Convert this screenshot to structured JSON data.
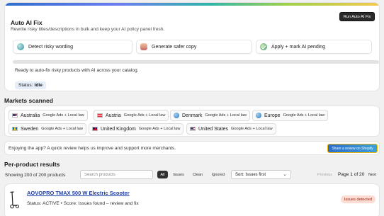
{
  "auto_fix": {
    "title": "Auto AI Fix",
    "subtitle": "Rewrite risky titles/descriptions in bulk and keep your AI policy panel fresh.",
    "run_button": "Run Auto AI Fix",
    "steps": [
      {
        "label": "Detect risky wording",
        "icon": "detect-icon"
      },
      {
        "label": "Generate safer copy",
        "icon": "generate-icon"
      },
      {
        "label": "Apply + mark AI pending",
        "icon": "check-icon"
      }
    ],
    "progress": 0,
    "message": "Ready to auto-fix risky products with AI across your catalog.",
    "status_label": "Status:",
    "status_value": "Idle"
  },
  "markets": {
    "title": "Markets scanned",
    "items": [
      {
        "name": "Australia",
        "scope": "Google Ads + Local law",
        "flag": "us"
      },
      {
        "name": "Austria",
        "scope": "Google Ads + Local law",
        "flag": "at"
      },
      {
        "name": "Denmark",
        "scope": "Google Ads + Local law",
        "flag": "globe"
      },
      {
        "name": "Europe",
        "scope": "Google Ads + Local law",
        "flag": "globe"
      },
      {
        "name": "Sweden",
        "scope": "Google Ads + Local law",
        "flag": "se"
      },
      {
        "name": "United Kingdom",
        "scope": "Google Ads + Local law",
        "flag": "uk"
      },
      {
        "name": "United States",
        "scope": "Google Ads + Local law",
        "flag": "us"
      }
    ]
  },
  "review": {
    "text": "Enjoying the app? A quick review helps us improve and support more merchants.",
    "button": "Share a review on Shopify"
  },
  "products": {
    "title": "Per-product results",
    "count": "Showing 200 of 200 products",
    "search_placeholder": "Search products",
    "filters": [
      "All",
      "Issues",
      "Clean",
      "Ignored"
    ],
    "active_filter": "All",
    "sort": "Sort: Issues first",
    "pager": {
      "prev": "Previous",
      "page": "Page 1 of 20",
      "next": "Next"
    },
    "items": [
      {
        "name": "AOVOPRO TMAX 500 W Electric Scooter",
        "status": "Status: ACTIVE • Score: Issues found – review and fix",
        "badge": "Issues detected"
      }
    ]
  },
  "colors": {
    "accent": "#2c6ecb",
    "critical_bg": "#fddcd4",
    "critical_text": "#8e1f0b"
  }
}
